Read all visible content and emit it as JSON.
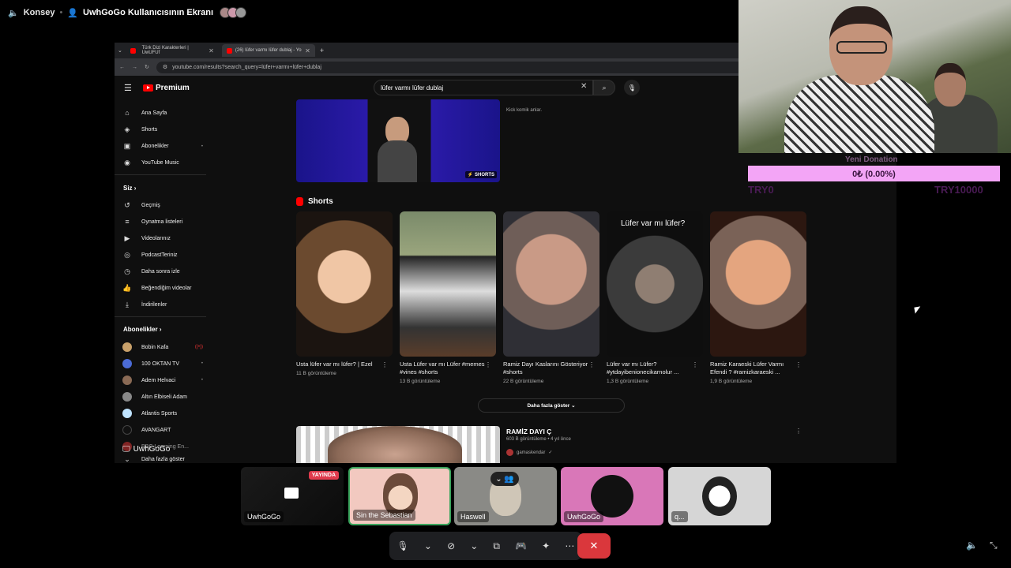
{
  "discord": {
    "channel": "Konsey",
    "screen_share_title": "UwhGoGo Kullanıcısının Ekranı",
    "sharer_name": "UwhGoGo",
    "participants": [
      {
        "name": "UwhGoGo",
        "live": "YAYINDA"
      },
      {
        "name": "Sin the Sebastian"
      },
      {
        "name": "Haswell"
      },
      {
        "name": "UwhGoGo"
      },
      {
        "name": "q..."
      }
    ]
  },
  "browser": {
    "tabs": [
      {
        "title": "Türk Dizi Karakterleri | UwUFUf"
      },
      {
        "title": "(26) lüfer varmı lüfer dublaj - Yo"
      }
    ],
    "url": "youtube.com/results?search_query=lüfer+varmı+lüfer+dublaj"
  },
  "youtube": {
    "logo_text": "Premium",
    "search_value": "lüfer varmı lüfer dublaj",
    "sidebar": {
      "main": [
        "Ana Sayfa",
        "Shorts",
        "Abonelikler",
        "YouTube Music"
      ],
      "you_header": "Siz",
      "you": [
        "Geçmiş",
        "Oynatma listeleri",
        "Videolarınız",
        "PodcastTeriniz",
        "Daha sonra izle",
        "Beğendiğim videolar",
        "İndirilenler"
      ],
      "subs_header": "Abonelikler",
      "channels": [
        "Bobin Kafa",
        "100 OKTAN TV",
        "Adem Helvaci",
        "Altın Elbiseli Adam",
        "Atlantis Sports",
        "AVANGART",
        "BBC Learning En..."
      ],
      "show_more": "Daha fazla göster"
    },
    "top_result": {
      "badge": "SHORTS",
      "desc": "Kick komik anlar."
    },
    "shorts_header": "Shorts",
    "shorts": [
      {
        "title": "Usta lüfer var mı lüfer? | Ezel",
        "views": "11 B görüntüleme"
      },
      {
        "title": "Usta Lüfer var mı Lüfer #memes #vines #shorts",
        "views": "13 B görüntüleme"
      },
      {
        "title": "Ramiz Dayı Kaslarını Gösteriyor #shorts",
        "views": "22 B görüntüleme"
      },
      {
        "title": "Lüfer var mı Lüfer? #ytdayibenionecikarnolur ...",
        "views": "1,3 B görüntüleme",
        "overlay": "Lüfer var mı lüfer?"
      },
      {
        "title": "Ramiz Karaeski Lüfer Varmı Efendi ? #ramizkaraeski ...",
        "views": "1,9 B görüntüleme"
      }
    ],
    "more_button": "Daha fazla göster",
    "bottom_video": {
      "title": "RAMİZ DAYI Ç",
      "meta": "603 B görüntüleme • 4 yıl önce",
      "channel": "gamaskendar"
    }
  },
  "overlay": {
    "donation_label": "Yeni Donation",
    "donation_value": "0₺ (0.00%)",
    "donation_progress": 0,
    "min": "TRY0",
    "max": "TRY10000"
  },
  "colors": {
    "accent": "#f3a5f6",
    "leave": "#da373c",
    "live": "#e03b4d",
    "yt_red": "#ff0000"
  }
}
